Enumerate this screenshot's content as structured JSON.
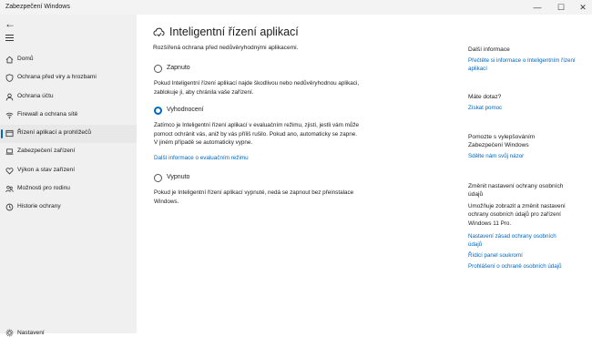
{
  "window": {
    "title": "Zabezpečení Windows",
    "controls": {
      "minimize": "—",
      "maximize": "☐",
      "close": "✕"
    }
  },
  "sidebar": {
    "back_label": "←",
    "items": [
      {
        "label": "Domů",
        "icon": "home-icon",
        "active": false
      },
      {
        "label": "Ochrana před viry a hrozbami",
        "icon": "shield-icon",
        "active": false
      },
      {
        "label": "Ochrana účtu",
        "icon": "person-icon",
        "active": false
      },
      {
        "label": "Firewall a ochrana sítě",
        "icon": "wifi-icon",
        "active": false
      },
      {
        "label": "Řízení aplikací a prohlížečů",
        "icon": "app-window-icon",
        "active": true
      },
      {
        "label": "Zabezpečení zařízení",
        "icon": "laptop-icon",
        "active": false
      },
      {
        "label": "Výkon a stav zařízení",
        "icon": "heart-icon",
        "active": false
      },
      {
        "label": "Možnosti pro rodinu",
        "icon": "family-icon",
        "active": false
      },
      {
        "label": "Historie ochrany",
        "icon": "history-icon",
        "active": false
      }
    ],
    "settings_label": "Nastavení"
  },
  "main": {
    "title": "Inteligentní řízení aplikací",
    "subtitle": "Rozšířená ochrana před nedůvěryhodnými aplikacemi.",
    "options": [
      {
        "label": "Zapnuto",
        "checked": false,
        "description": "Pokud Inteligentní řízení aplikací najde škodlivou nebo nedůvěryhodnou aplikaci, zablokuje ji, aby chránila vaše zařízení."
      },
      {
        "label": "Vyhodnocení",
        "checked": true,
        "description": "Zatímco je Inteligentní řízení aplikací v evaluačním režimu, zjistí, jestli vám může pomoct ochránit vás, aniž by vás příliš rušilo. Pokud ano, automaticky se zapne. V jiném případě se automaticky vypne.",
        "link": "Další informace o evaluačním režimu"
      },
      {
        "label": "Vypnuto",
        "checked": false,
        "description": "Pokud je Inteligentní řízení aplikací vypnuté, nedá se zapnout bez přeinstalace Windows."
      }
    ]
  },
  "right": {
    "more_info": {
      "heading": "Další informace",
      "link": "Přečtěte si informace o Inteligentním řízení aplikací"
    },
    "question": {
      "heading": "Máte dotaz?",
      "link": "Získat pomoc"
    },
    "improve": {
      "heading": "Pomozte s vylepšováním Zabezpečení Windows",
      "link": "Sdělte nám svůj názor"
    },
    "privacy": {
      "heading": "Změnit nastavení ochrany osobních údajů",
      "text": "Umožňuje zobrazit a změnit nastavení ochrany osobních údajů pro zařízení Windows 11 Pro.",
      "links": [
        "Nastavení zásad ochrany osobních údajů",
        "Řídicí panel soukromí",
        "Prohlášení o ochraně osobních údajů"
      ]
    }
  },
  "colors": {
    "accent": "#0067c0",
    "sidebar_bg": "#f0f0f0",
    "selected_bg": "#e8e8e8"
  }
}
